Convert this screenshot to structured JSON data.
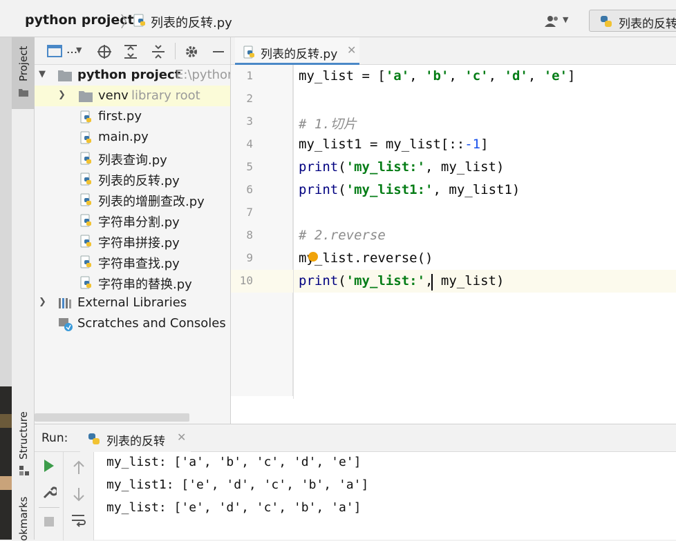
{
  "navbar": {
    "project": "python project",
    "file": "列表的反转.py",
    "run_config": "列表的反转"
  },
  "sidebar": {
    "project_tab": "Project",
    "structure_tab": "Structure",
    "bookmarks_tab": "okmarks"
  },
  "project_toolbar": {
    "view_label": "..."
  },
  "tree": {
    "root": {
      "label": "python project",
      "path": "E:\\python"
    },
    "venv": {
      "label": "venv",
      "hint": "library root"
    },
    "files": [
      "first.py",
      "main.py",
      "列表查询.py",
      "列表的反转.py",
      "列表的增删查改.py",
      "字符串分割.py",
      "字符串拼接.py",
      "字符串查找.py",
      "字符串的替换.py"
    ],
    "external_libraries": "External Libraries",
    "scratches": "Scratches and Consoles"
  },
  "editor": {
    "tab_label": "列表的反转.py",
    "line_numbers": [
      "1",
      "2",
      "3",
      "4",
      "5",
      "6",
      "7",
      "8",
      "9",
      "10"
    ],
    "current_line": 10
  },
  "run": {
    "label": "Run:",
    "tab_label": "列表的反转",
    "output": [
      "my_list: ['a', 'b', 'c', 'd', 'e']",
      "my_list1: ['e', 'd', 'c', 'b', 'a']",
      "my_list: ['e', 'd', 'c', 'b', 'a']"
    ]
  },
  "code": {
    "l1": {
      "a": "my_list = [",
      "b": "'a'",
      "c": ", ",
      "d": "'b'",
      "e": ", ",
      "f": "'c'",
      "g": ", ",
      "h": "'d'",
      "i": ", ",
      "j": "'e'",
      "k": "]"
    },
    "l3": {
      "a": "# 1.切片"
    },
    "l4": {
      "a": "my_list1 = my_list[::",
      "b": "-1",
      "c": "]"
    },
    "l5": {
      "a": "print",
      "b": "(",
      "c": "'my_list:'",
      "d": ", my_list)"
    },
    "l6": {
      "a": "print",
      "b": "(",
      "c": "'my_list1:'",
      "d": ", my_list1)"
    },
    "l8": {
      "a": "# 2.reverse"
    },
    "l9": {
      "a": "my_list.reverse()"
    },
    "l10": {
      "a": "print",
      "b": "(",
      "c": "'my_list:'",
      "d": ", my_list)"
    }
  },
  "colors": {
    "string": "#067d17",
    "number": "#1750eb",
    "comment": "#8c8c8c",
    "builtin": "#000080",
    "selection": "#fbfbd8",
    "tab_underline": "#4a88c7",
    "run_green": "#3c9c4a"
  },
  "icons": [
    "python-file-icon",
    "folder-icon",
    "library-icon",
    "scratches-icon",
    "user-icon",
    "locate-icon",
    "expand-icon",
    "collapse-icon",
    "gear-icon",
    "minimize-icon",
    "run-icon",
    "wrench-icon",
    "stop-icon",
    "arrow-up-icon",
    "arrow-down-icon",
    "soft-wrap-icon",
    "bulb-icon"
  ]
}
